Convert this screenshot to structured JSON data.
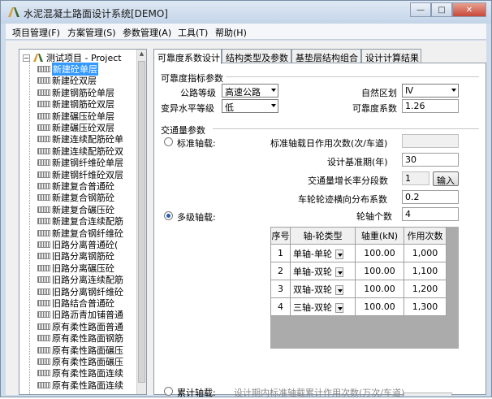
{
  "window": {
    "title": "水泥混凝土路面设计系统[DEMO]"
  },
  "menu": [
    "项目管理(F)",
    "方案管理(S)",
    "参数管理(A)",
    "工具(T)",
    "帮助(H)"
  ],
  "tree": {
    "root": "测试项目 - Project",
    "root_expander": "−",
    "selected_index": 0,
    "items": [
      "新建砼单层",
      "新建砼双层",
      "新建钢筋砼单层",
      "新建钢筋砼双层",
      "新建碾压砼单层",
      "新建碾压砼双层",
      "新建连续配筋砼单",
      "新建连续配筋砼双",
      "新建钢纤维砼单层",
      "新建钢纤维砼双层",
      "新建复合普通砼",
      "新建复合钢筋砼",
      "新建复合碾压砼",
      "新建复合连续配筋",
      "新建复合钢纤维砼",
      "旧路分离普通砼(",
      "旧路分离钢筋砼",
      "旧路分离碾压砼",
      "旧路分离连续配筋",
      "旧路分离钢纤维砼",
      "旧路结合普通砼",
      "旧路沥青加铺普通",
      "原有柔性路面普通",
      "原有柔性路面钢筋",
      "原有柔性路面碾压",
      "原有柔性路面碾压",
      "原有柔性路面连续",
      "原有柔性路面连续"
    ]
  },
  "tabs": [
    "可靠度系数设计",
    "结构类型及参数",
    "基垫层结构组合",
    "设计计算结果"
  ],
  "reliability": {
    "group_title": "可靠度指标参数",
    "road_grade_label": "公路等级",
    "road_grade_value": "高速公路",
    "natural_zone_label": "自然区划",
    "natural_zone_value": "Ⅳ",
    "variability_label": "变异水平等级",
    "variability_value": "低",
    "reliability_coef_label": "可靠度系数",
    "reliability_coef_value": "1.26"
  },
  "traffic": {
    "group_title": "交通量参数",
    "standard_axle_label": "标准轴载:",
    "daily_repetitions_label": "标准轴载日作用次数(次/车道)",
    "daily_repetitions_value": "",
    "design_period_label": "设计基准期(年)",
    "design_period_value": "30",
    "growth_segments_label": "交通量增长率分段数",
    "growth_segments_value": "1",
    "input_button": "输入",
    "lateral_dist_label": "车轮轮迹横向分布系数",
    "lateral_dist_value": "0.2",
    "multi_axle_label": "多级轴载:",
    "axle_count_label": "轮轴个数",
    "axle_count_value": "4",
    "cumulative_label": "累计轴载:",
    "cumulative_desc": "设计期内标准轴载累计作用次数(万次/车道)",
    "selected_mode": "multi"
  },
  "axle_table": {
    "headers": [
      "序号",
      "轴-轮类型",
      "轴重(kN)",
      "作用次数"
    ],
    "rows": [
      {
        "no": "1",
        "type": "单轴-单轮",
        "load": "100.00",
        "count": "1,000"
      },
      {
        "no": "2",
        "type": "单轴-双轮",
        "load": "100.00",
        "count": "1,100"
      },
      {
        "no": "3",
        "type": "双轴-双轮",
        "load": "100.00",
        "count": "1,200"
      },
      {
        "no": "4",
        "type": "三轴-双轮",
        "load": "100.00",
        "count": "1,300"
      }
    ]
  },
  "caption_buttons": {
    "minimize": "—",
    "maximize": "□",
    "close": "✕"
  },
  "colors": {
    "selection": "#3399ff",
    "titlebar": "#c4d4e8"
  }
}
